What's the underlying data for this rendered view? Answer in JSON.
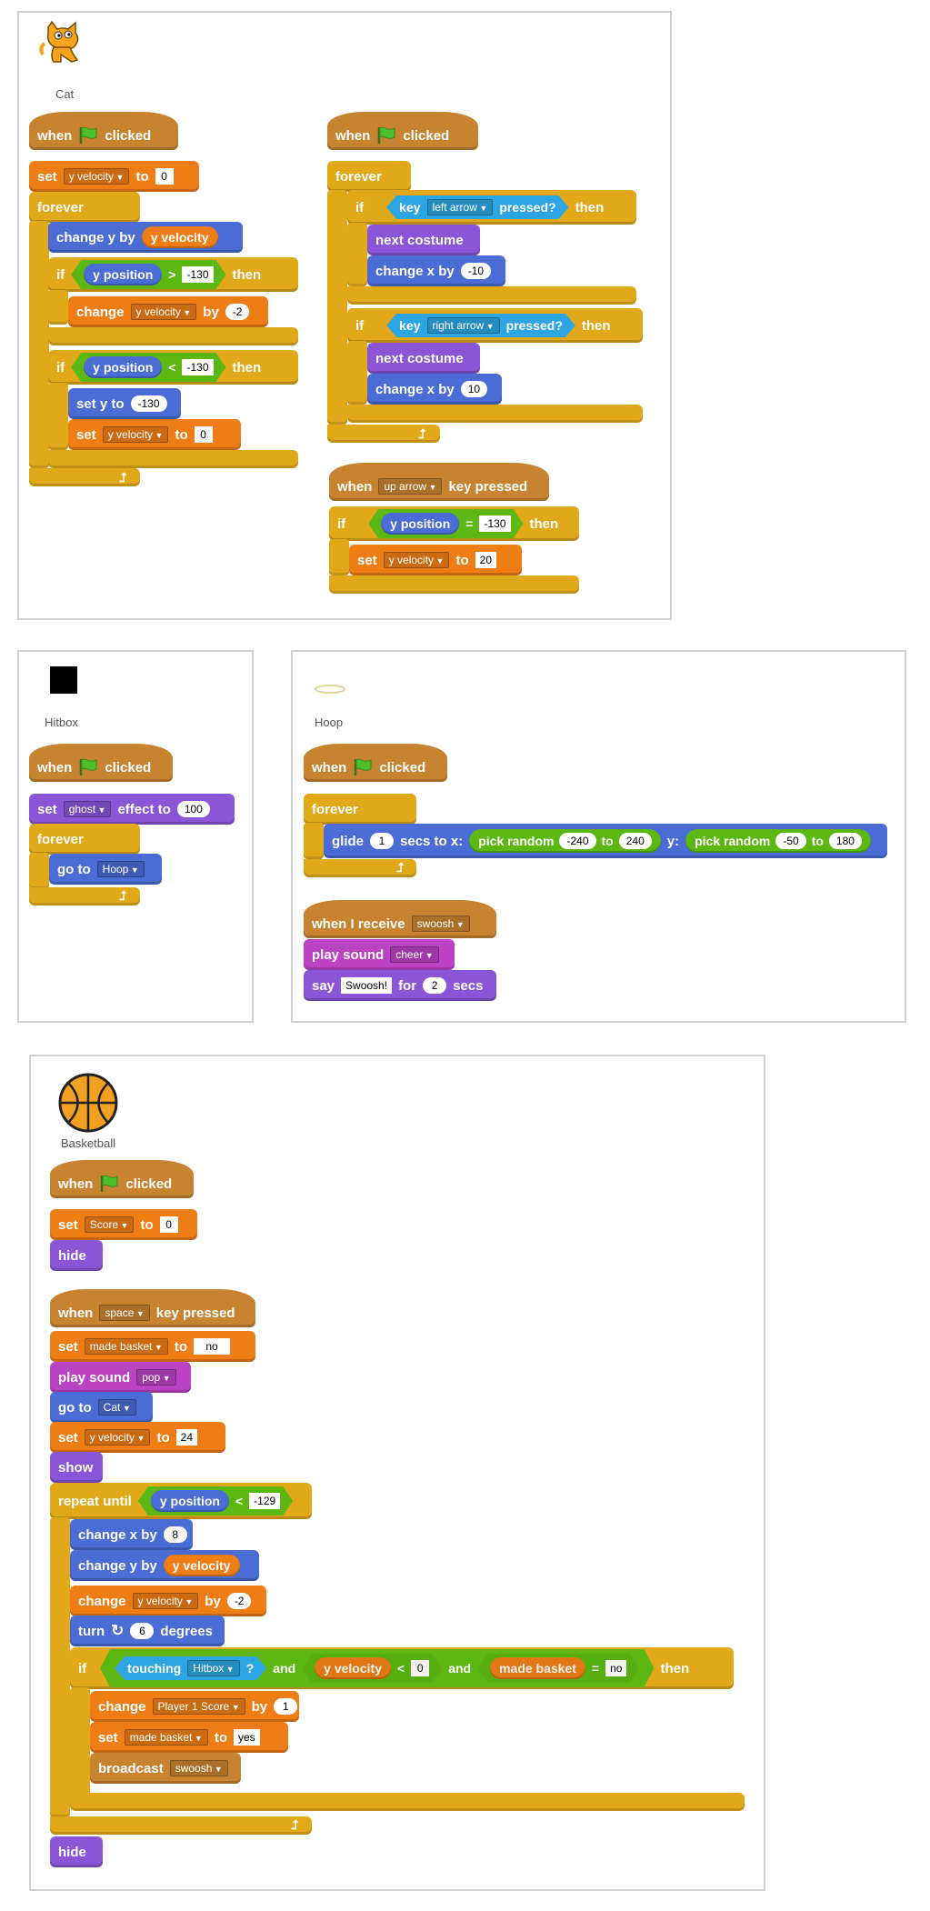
{
  "sprites": {
    "cat": {
      "name": "Cat",
      "s1": {
        "hat": {
          "when": "when",
          "clicked": "clicked"
        },
        "set1": {
          "kw": "set",
          "var": "y velocity",
          "to": "to",
          "val": "0"
        },
        "forever": "forever",
        "change_y": {
          "kw": "change y by",
          "rep": "y velocity"
        },
        "if1": {
          "kw": "if",
          "rep": "y position",
          "op": ">",
          "val": "-130",
          "then": "then"
        },
        "if1_body": {
          "kw": "change",
          "var": "y velocity",
          "by": "by",
          "val": "-2"
        },
        "if2": {
          "kw": "if",
          "rep": "y position",
          "op": "<",
          "val": "-130",
          "then": "then"
        },
        "if2_b1": {
          "kw": "set y to",
          "val": "-130"
        },
        "if2_b2": {
          "kw": "set",
          "var": "y velocity",
          "to": "to",
          "val": "0"
        }
      },
      "s2": {
        "hat": {
          "when": "when",
          "clicked": "clicked"
        },
        "forever": "forever",
        "if1": {
          "kw": "if",
          "key": "key",
          "opt": "left arrow",
          "pressed": "pressed?",
          "then": "then"
        },
        "if1_b1": {
          "kw": "next costume"
        },
        "if1_b2": {
          "kw": "change x by",
          "val": "-10"
        },
        "if2": {
          "kw": "if",
          "key": "key",
          "opt": "right arrow",
          "pressed": "pressed?",
          "then": "then"
        },
        "if2_b1": {
          "kw": "next costume"
        },
        "if2_b2": {
          "kw": "change x by",
          "val": "10"
        }
      },
      "s3": {
        "hat": {
          "when": "when",
          "opt": "up arrow",
          "rest": "key pressed"
        },
        "if1": {
          "kw": "if",
          "rep": "y position",
          "op": "=",
          "val": "-130",
          "then": "then"
        },
        "if1_b1": {
          "kw": "set",
          "var": "y velocity",
          "to": "to",
          "val": "20"
        }
      }
    },
    "hitbox": {
      "name": "Hitbox",
      "hat": {
        "when": "when",
        "clicked": "clicked"
      },
      "set1": {
        "kw": "set",
        "opt": "ghost",
        "rest": "effect to",
        "val": "100"
      },
      "forever": "forever",
      "goto": {
        "kw": "go to",
        "opt": "Hoop"
      }
    },
    "hoop": {
      "name": "Hoop",
      "hat": {
        "when": "when",
        "clicked": "clicked"
      },
      "forever": "forever",
      "glide": {
        "kw": "glide",
        "secs_val": "1",
        "secs": "secs to x:",
        "pr1": "pick random",
        "a1": "-240",
        "to1": "to",
        "b1": "240",
        "y": "y:",
        "pr2": "pick random",
        "a2": "-50",
        "to2": "to",
        "b2": "180"
      },
      "recv": {
        "kw": "when I receive",
        "opt": "swoosh"
      },
      "play": {
        "kw": "play sound",
        "opt": "cheer"
      },
      "say": {
        "kw": "say",
        "text": "Swoosh!",
        "for": "for",
        "val": "2",
        "secs": "secs"
      }
    },
    "ball": {
      "name": "Basketball",
      "s1": {
        "hat": {
          "when": "when",
          "clicked": "clicked"
        },
        "set1": {
          "kw": "set",
          "var": "Score",
          "to": "to",
          "val": "0"
        },
        "hide": "hide"
      },
      "s2": {
        "hat": {
          "when": "when",
          "opt": "space",
          "rest": "key pressed"
        },
        "set1": {
          "kw": "set",
          "var": "made basket",
          "to": "to",
          "val": "no"
        },
        "play": {
          "kw": "play sound",
          "opt": "pop"
        },
        "goto": {
          "kw": "go to",
          "opt": "Cat"
        },
        "set2": {
          "kw": "set",
          "var": "y velocity",
          "to": "to",
          "val": "24"
        },
        "show": "show",
        "repeat": {
          "kw": "repeat until",
          "rep": "y position",
          "op": "<",
          "val": "-129"
        },
        "cx": {
          "kw": "change x by",
          "val": "8"
        },
        "cy": {
          "kw": "change y by",
          "rep": "y velocity"
        },
        "cv": {
          "kw": "change",
          "var": "y velocity",
          "by": "by",
          "val": "-2"
        },
        "turn": {
          "kw": "turn",
          "val": "6",
          "deg": "degrees"
        },
        "if1": {
          "kw": "if",
          "touching": "touching",
          "opt": "Hitbox",
          "q": "?",
          "and1": "and",
          "rep": "y velocity",
          "op": "<",
          "v": "0",
          "and2": "and",
          "rep2": "made basket",
          "eq": "=",
          "v2": "no",
          "then": "then"
        },
        "if_b1": {
          "kw": "change",
          "var": "Player 1 Score",
          "by": "by",
          "val": "1"
        },
        "if_b2": {
          "kw": "set",
          "var": "made basket",
          "to": "to",
          "val": "yes"
        },
        "if_b3": {
          "kw": "broadcast",
          "opt": "swoosh"
        },
        "hide": "hide"
      }
    }
  },
  "colors": {
    "control": "#e1a91a",
    "events": "#c88330",
    "variables": "#ee7d16",
    "motion": "#4a6cd4",
    "looks": "#8a55d7",
    "sound": "#bb42c3",
    "operators": "#5cb712",
    "sensing": "#2ca5e2"
  },
  "icons": [
    "green-flag-icon",
    "turn-right-icon",
    "loop-arrow-icon"
  ]
}
